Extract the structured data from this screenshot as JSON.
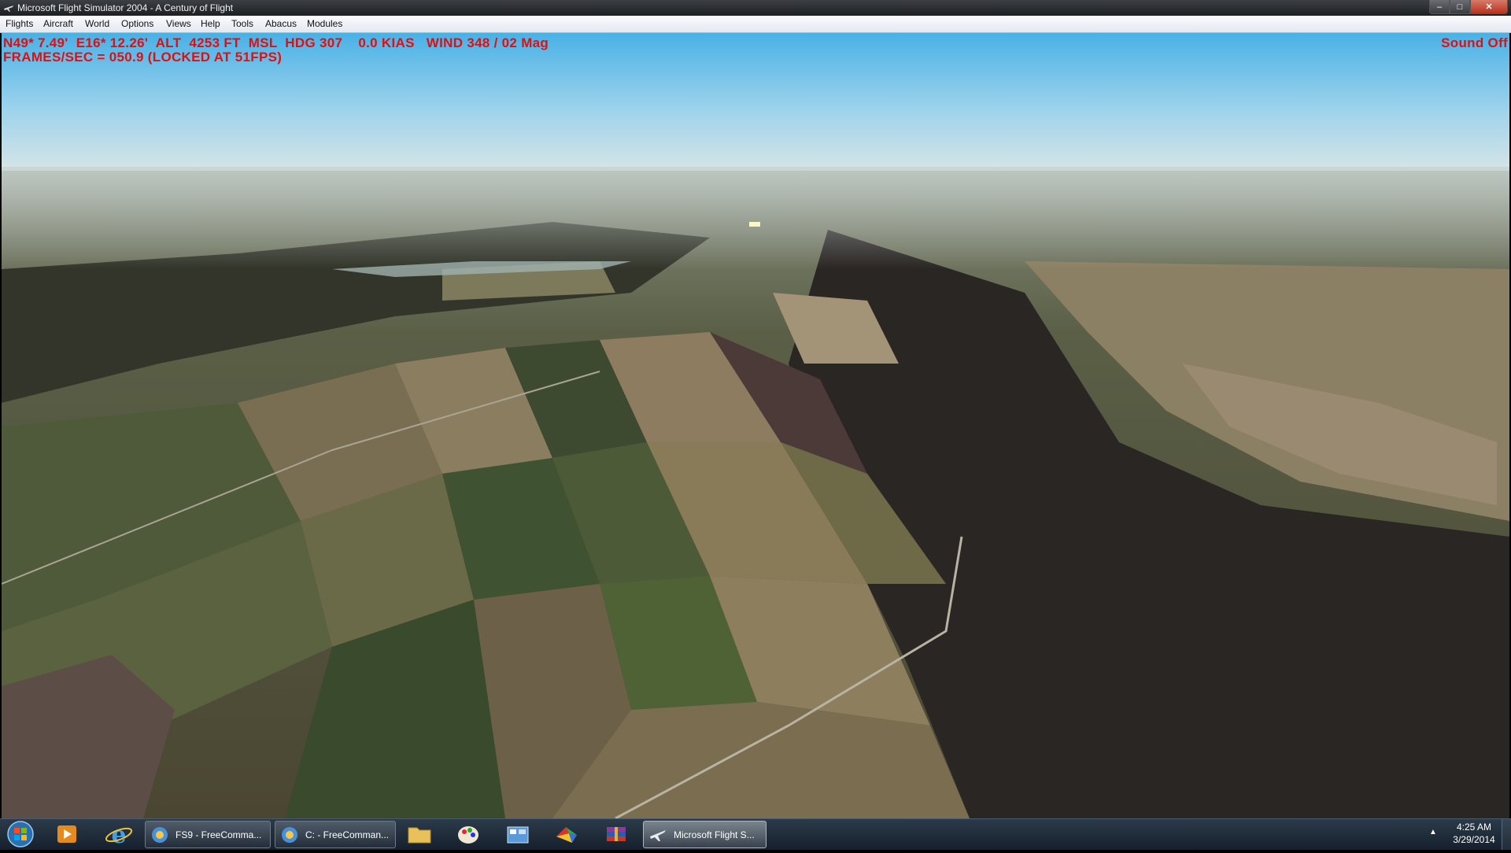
{
  "window": {
    "title": "Microsoft Flight Simulator 2004 - A Century of Flight",
    "buttons": {
      "minimize": "–",
      "maximize": "□",
      "close": "✕"
    }
  },
  "menu": [
    "Flights",
    "Aircraft",
    "World",
    "Options",
    "Views",
    "Help",
    "Tools",
    "Abacus",
    "Modules"
  ],
  "hud": {
    "line1": "N49* 7.49'  E16* 12.26'  ALT  4253 FT  MSL  HDG 307    0.0 KIAS   WIND 348 / 02 Mag",
    "line2": "FRAMES/SEC = 050.9 (LOCKED AT 51FPS)",
    "sound": "Sound Off",
    "color": "#e01010"
  },
  "taskbar": {
    "start_icon": "windows-orb-icon",
    "pinned": [
      "media-player-icon",
      "internet-explorer-icon"
    ],
    "tasks": [
      {
        "label": "FS9 - FreeComma...",
        "icon": "freecommander-icon"
      },
      {
        "label": "C: - FreeComman...",
        "icon": "freecommander-icon"
      }
    ],
    "pinned2": [
      "file-explorer-icon",
      "paint-icon",
      "control-panel-icon",
      "colorful-app-icon",
      "winrar-icon"
    ],
    "active_task": {
      "label": "Microsoft Flight S...",
      "icon": "airplane-icon"
    },
    "clock": {
      "time": "4:25 AM",
      "date": "3/29/2014"
    }
  }
}
